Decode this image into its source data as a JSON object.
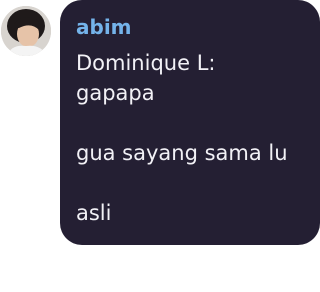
{
  "message": {
    "sender": "abim",
    "lines": [
      "Dominique L:",
      "gapapa",
      "",
      "gua sayang sama lu",
      "",
      "asli"
    ]
  },
  "colors": {
    "bubble_background": "#241f33",
    "sender_name": "#74b3ea",
    "message_text": "#f2f1f6",
    "page_background": "#ffffff"
  },
  "icons": {
    "avatar": "user-profile-photo"
  }
}
